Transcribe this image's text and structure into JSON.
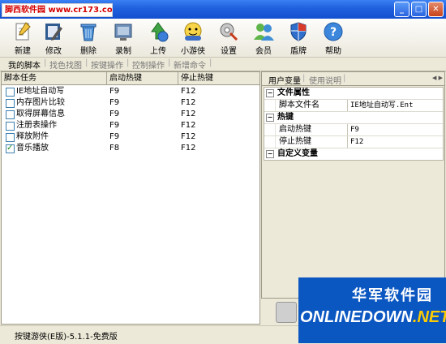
{
  "titlebar": {
    "watermark_text": "脚西软件园 www.cr173.com",
    "buttons": [
      "_",
      "□",
      "✕"
    ]
  },
  "toolbar": {
    "buttons": [
      {
        "label": "新建",
        "icon": "new-icon"
      },
      {
        "label": "修改",
        "icon": "edit-icon"
      },
      {
        "label": "删除",
        "icon": "delete-icon"
      },
      {
        "label": "录制",
        "icon": "record-icon"
      },
      {
        "label": "上传",
        "icon": "upload-icon"
      },
      {
        "label": "小游侠",
        "icon": "game-icon"
      },
      {
        "label": "设置",
        "icon": "settings-icon"
      },
      {
        "label": "会员",
        "icon": "members-icon"
      },
      {
        "label": "盾牌",
        "icon": "shield-icon"
      },
      {
        "label": "帮助",
        "icon": "help-icon"
      }
    ]
  },
  "tabs": [
    "我的脚本",
    "找色找图",
    "按键操作",
    "控制操作",
    "新增命令"
  ],
  "grid": {
    "headers": [
      "脚本任务",
      "启动热键",
      "停止热键"
    ],
    "rows": [
      {
        "name": "IE地址自动写",
        "start": "F9",
        "stop": "F12",
        "checked": false
      },
      {
        "name": "内存图片比较",
        "start": "F9",
        "stop": "F12",
        "checked": false
      },
      {
        "name": "取得屏幕信息",
        "start": "F9",
        "stop": "F12",
        "checked": false
      },
      {
        "name": "注册表操作",
        "start": "F9",
        "stop": "F12",
        "checked": false
      },
      {
        "name": "释放附件",
        "start": "F9",
        "stop": "F12",
        "checked": false
      },
      {
        "name": "音乐播放",
        "start": "F8",
        "stop": "F12",
        "checked": true
      }
    ]
  },
  "right_tabs": [
    "用户变量",
    "使用说明"
  ],
  "properties": {
    "file_category": "文件属性",
    "script_file_label": "脚本文件名",
    "script_file_value": "IE地址自动写.Ent",
    "hotkey_category": "热键",
    "start_hotkey_label": "启动热键",
    "start_hotkey_value": "F9",
    "stop_hotkey_label": "停止热键",
    "stop_hotkey_value": "F12",
    "custom_var_category": "自定义变量"
  },
  "status": {
    "text": "按键游侠(E版)-5.1.1-免费版"
  },
  "logo": {
    "top_text": "华军软件园",
    "bottom_text": "ONLINEDOWN",
    "bottom_suffix": ".NET"
  }
}
